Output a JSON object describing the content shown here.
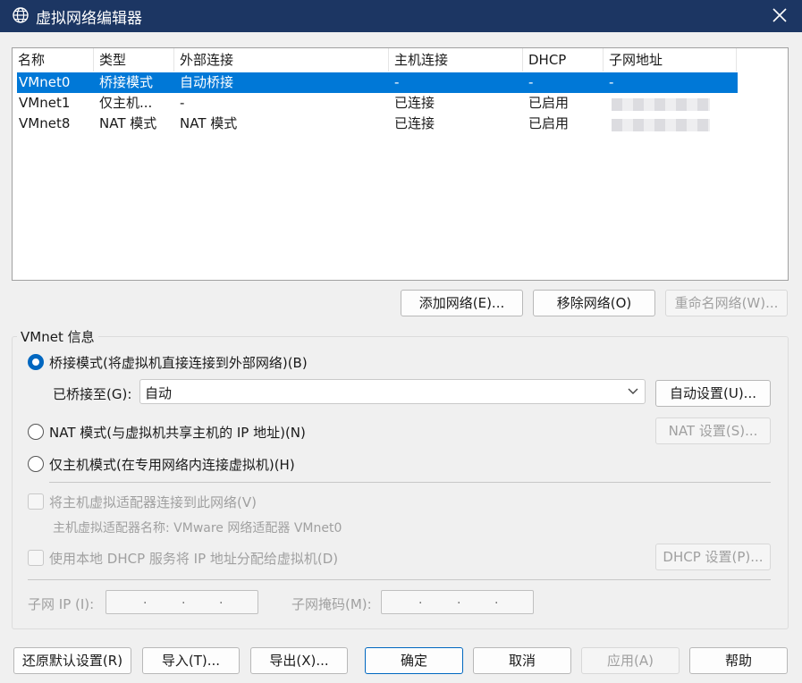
{
  "window": {
    "title": "虚拟网络编辑器"
  },
  "list": {
    "headers": [
      "名称",
      "类型",
      "外部连接",
      "主机连接",
      "DHCP",
      "子网地址"
    ],
    "rows": [
      {
        "name": "VMnet0",
        "type": "桥接模式",
        "external": "自动桥接",
        "host": "-",
        "dhcp": "-",
        "subnet": "-",
        "selected": true
      },
      {
        "name": "VMnet1",
        "type": "仅主机...",
        "external": "-",
        "host": "已连接",
        "dhcp": "已启用",
        "subnet": "",
        "selected": false
      },
      {
        "name": "VMnet8",
        "type": "NAT 模式",
        "external": "NAT 模式",
        "host": "已连接",
        "dhcp": "已启用",
        "subnet": "",
        "selected": false
      }
    ]
  },
  "list_buttons": {
    "add": "添加网络(E)...",
    "remove": "移除网络(O)",
    "rename": "重命名网络(W)..."
  },
  "info": {
    "group_title": "VMnet 信息",
    "bridged_label": "桥接模式(将虚拟机直接连接到外部网络)(B)",
    "bridged_to_label": "已桥接至(G):",
    "bridged_to_value": "自动",
    "auto_settings": "自动设置(U)...",
    "nat_label": "NAT 模式(与虚拟机共享主机的 IP 地址)(N)",
    "nat_settings": "NAT 设置(S)...",
    "hostonly_label": "仅主机模式(在专用网络内连接虚拟机)(H)",
    "connect_adapter_label": "将主机虚拟适配器连接到此网络(V)",
    "adapter_name_label": "主机虚拟适配器名称: VMware 网络适配器 VMnet0",
    "dhcp_label": "使用本地 DHCP 服务将 IP 地址分配给虚拟机(D)",
    "dhcp_settings": "DHCP 设置(P)...",
    "subnet_ip_label": "子网 IP (I):",
    "subnet_mask_label": "子网掩码(M):",
    "selected_mode": "bridged"
  },
  "footer": {
    "restore": "还原默认设置(R)",
    "import": "导入(T)...",
    "export": "导出(X)...",
    "ok": "确定",
    "cancel": "取消",
    "apply": "应用(A)",
    "help": "帮助"
  },
  "colors": {
    "titlebar": "#1c3663",
    "selection": "#0078d7",
    "accent": "#0067c0"
  },
  "icons": {
    "app": "globe-network-icon",
    "close": "close-icon",
    "dropdown": "chevron-down-icon"
  }
}
